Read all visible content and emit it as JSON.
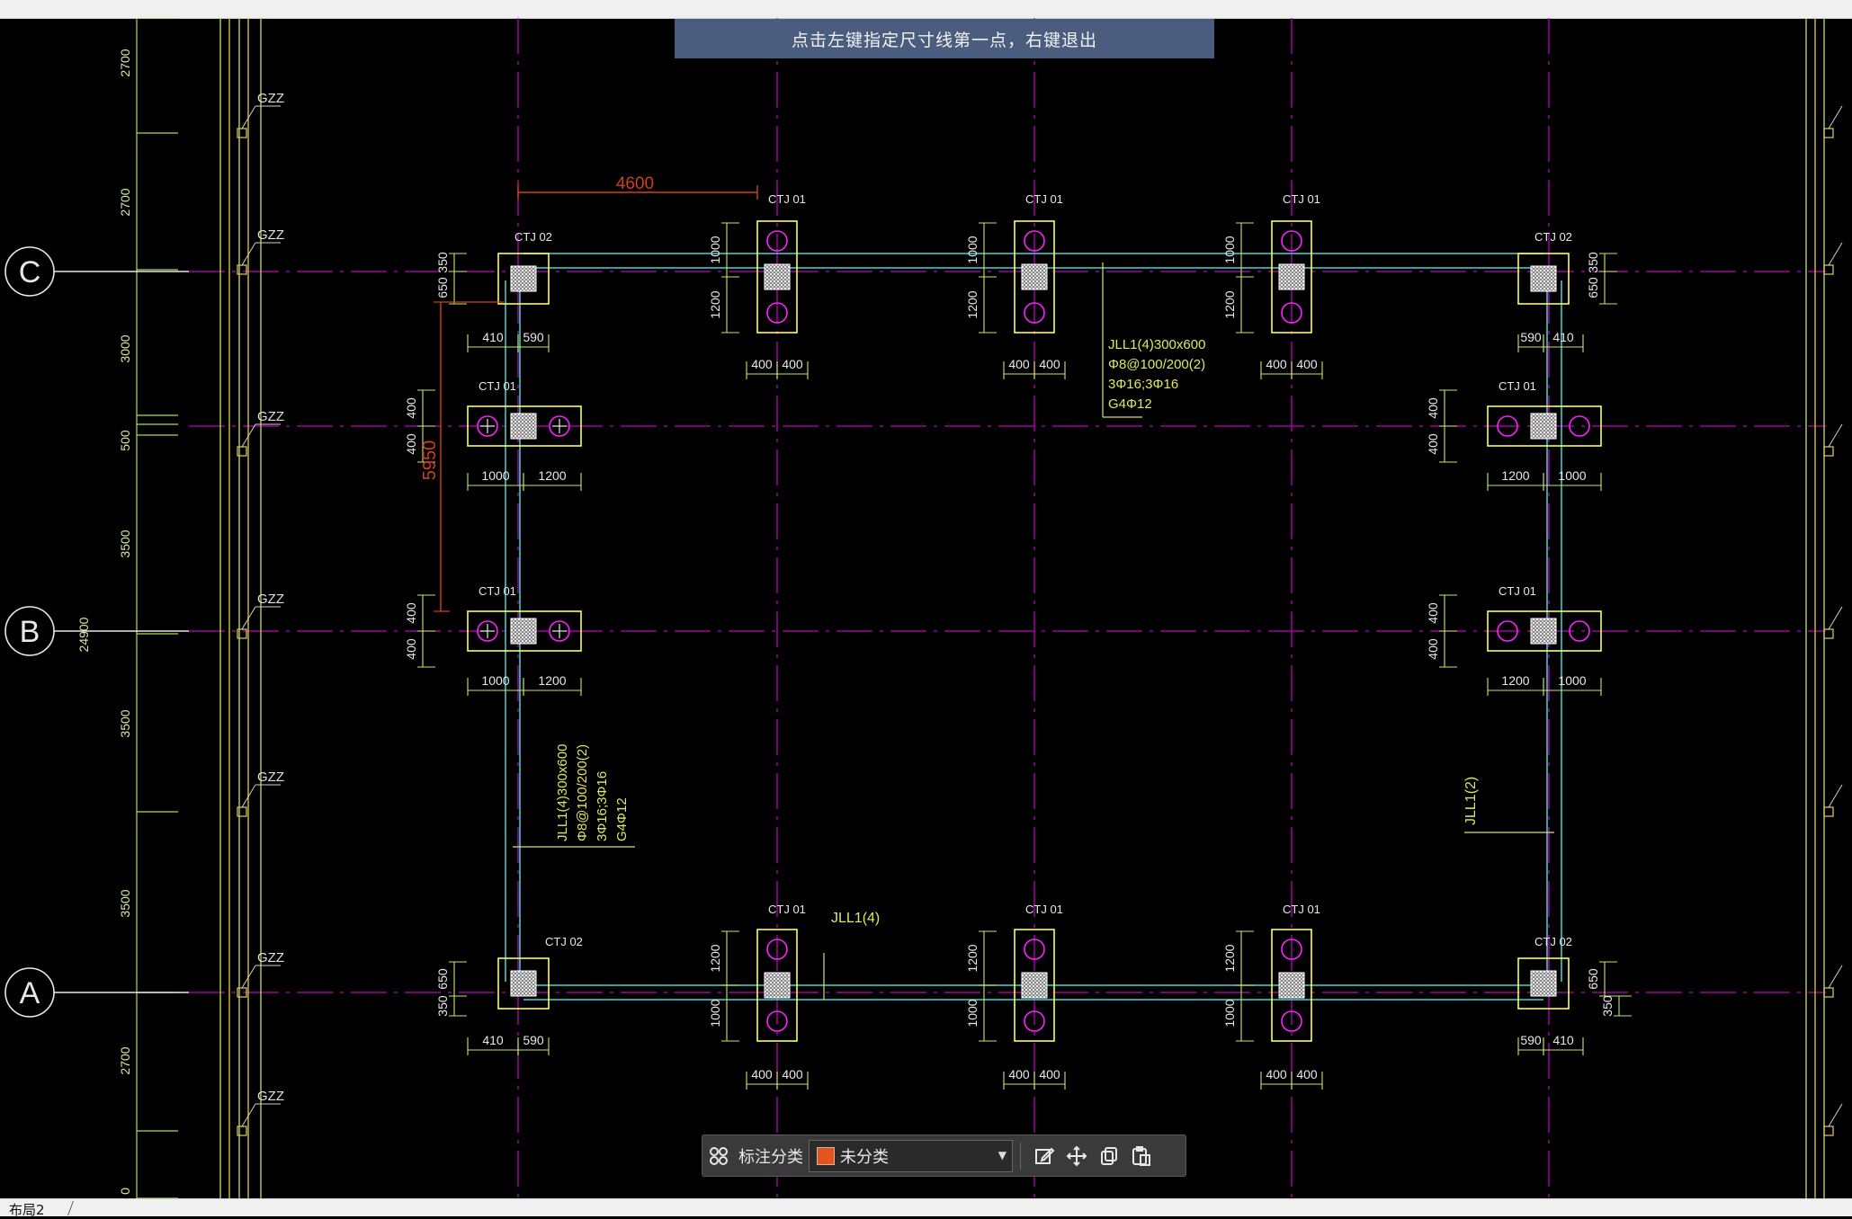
{
  "hint": "点击左键指定尺寸线第一点，右键退出",
  "toolbar": {
    "category_label": "标注分类",
    "category_value": "未分类",
    "swatch_color": "#e8531c"
  },
  "layout_tab": "布局2",
  "axes": [
    {
      "label": "C",
      "key": "C"
    },
    {
      "label": "B",
      "key": "B"
    },
    {
      "label": "A",
      "key": "A"
    }
  ],
  "gzz_label": "GZZ",
  "left_dims": [
    "2700",
    "2700",
    "3000",
    "500",
    "3500",
    "3500",
    "3500",
    "2700",
    "0"
  ],
  "overall_dim": "24900",
  "measure": {
    "horizontal": "4600",
    "vertical": "5950"
  },
  "ctj01": "CTJ 01",
  "ctj02": "CTJ 02",
  "dims": {
    "d350": "350",
    "d650": "650",
    "d410": "410",
    "d590": "590",
    "d400": "400",
    "d1000": "1000",
    "d1200": "1200"
  },
  "beam_notes": {
    "top": [
      "JLL1(4)300x600",
      "Φ8@100/200(2)",
      "3Φ16;3Φ16",
      "G4Φ12"
    ],
    "left": [
      "JLL1(4)300x600",
      "Φ8@100/200(2)",
      "3Φ16;3Φ16",
      "G4Φ12"
    ],
    "bottom": "JLL1(4)",
    "right": "JLL1(2)"
  },
  "colors": {
    "background": "#000000",
    "axis_line": "#c000c0",
    "beam": "#4dd2d2",
    "pile_cap": "#ffff40",
    "dimension": "#c8e85a",
    "pile_circle": "#ff20ff",
    "measure": "#d0401a",
    "hint_bg": "#4a5d7e"
  }
}
